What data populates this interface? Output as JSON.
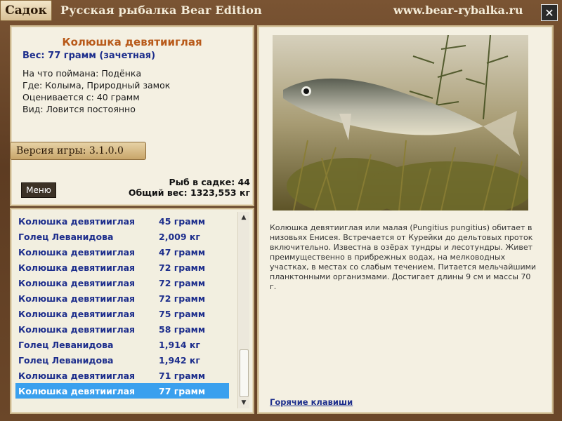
{
  "window": {
    "tab_label": "Садок",
    "title": "Русская рыбалка Bear Edition",
    "url": "www.bear-rybalka.ru",
    "close_label": "✕"
  },
  "fish": {
    "name": "Колюшка девятииглая",
    "weight": "Вес: 77 грамм (зачетная)",
    "bait": "На что поймана: Подёнка",
    "location": "Где: Колыма, Природный замок",
    "valued_from": "Оценивается с: 40 грамм",
    "type": "Вид: Ловится постоянно"
  },
  "version": "Версия игры: 3.1.0.0",
  "menu_label": "Меню",
  "stats": {
    "fish_count": "Рыб в садке: 44",
    "total_weight": "Общий вес: 1323,553 кг"
  },
  "catch_list": [
    {
      "name": "Колюшка девятииглая",
      "weight": "45 грамм"
    },
    {
      "name": "Голец Леванидова",
      "weight": "2,009 кг"
    },
    {
      "name": "Колюшка девятииглая",
      "weight": "47 грамм"
    },
    {
      "name": "Колюшка девятииглая",
      "weight": "72 грамм"
    },
    {
      "name": "Колюшка девятииглая",
      "weight": "72 грамм"
    },
    {
      "name": "Колюшка девятииглая",
      "weight": "72 грамм"
    },
    {
      "name": "Колюшка девятииглая",
      "weight": "75 грамм"
    },
    {
      "name": "Колюшка девятииглая",
      "weight": "58 грамм"
    },
    {
      "name": "Голец Леванидова",
      "weight": "1,914 кг"
    },
    {
      "name": "Голец Леванидова",
      "weight": "1,942 кг"
    },
    {
      "name": "Колюшка девятииглая",
      "weight": "71 грамм"
    },
    {
      "name": "Колюшка девятииглая",
      "weight": "77 грамм"
    }
  ],
  "selected_index": 11,
  "description": "Колюшка девятииглая или малая (Pungitius pungitius) обитает в низовьях Енисея. Встречается от Курейки до дельтовых проток включительно. Известна в озёрах тундры и лесотундры. Живет преимущественно в прибрежных водах, на мелководных участках, в местах со слабым течением. Питается мельчайшими планктонными организмами. Достигает длины 9 см и массы 70 г.",
  "hotkeys_link": "Горячие клавиши",
  "colors": {
    "accent_orange": "#b85a1a",
    "link_blue": "#1d2e8c",
    "selection_blue": "#3aa0ee"
  }
}
